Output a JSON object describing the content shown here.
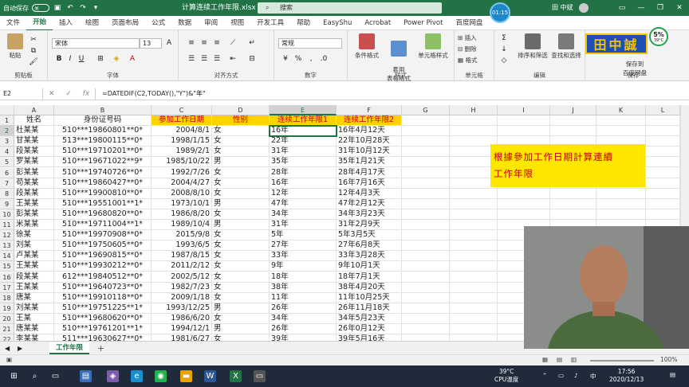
{
  "titlebar": {
    "autosave_label": "自动保存",
    "autosave_state": "关",
    "doc_title": "计算连续工作年限.xlsx",
    "search_placeholder": "搜索",
    "timer": "01:15",
    "user_name": "田 中斌",
    "win_minimize": "—",
    "win_restore": "❐",
    "win_close": "✕"
  },
  "tabs": [
    "文件",
    "开始",
    "插入",
    "绘图",
    "页面布局",
    "公式",
    "数据",
    "审阅",
    "视图",
    "开发工具",
    "帮助",
    "EasyShu",
    "Acrobat",
    "Power Pivot",
    "百度网盘"
  ],
  "active_tab": "开始",
  "ribbon": {
    "paste": "粘贴",
    "clipboard": "剪贴板",
    "font_name": "宋体",
    "font_size": "13",
    "font_group": "字体",
    "align_group": "对齐方式",
    "number_format": "常规",
    "number_group": "数字",
    "conditional": "条件格式",
    "table_format": "套用\n表格格式",
    "cell_style": "单元格样式",
    "styles_group": "样式",
    "insert": "插入",
    "delete": "删除",
    "format": "格式",
    "cells_group": "单元格",
    "sort_filter": "排序和筛选",
    "find_select": "查找和选择",
    "edit_group": "编辑",
    "save_to": "保存到\n百度网盘",
    "save_group": "保存",
    "logo_text": "田中誠",
    "badge_pct": "5%",
    "badge_temp": "39°C"
  },
  "formula_bar": {
    "name_box": "E2",
    "cancel": "✕",
    "enter": "✓",
    "fx": "fx",
    "formula": "=DATEDIF(C2,TODAY(),\"Y\")&\"年\""
  },
  "columns": [
    "A",
    "B",
    "C",
    "D",
    "E",
    "F",
    "G",
    "H",
    "I",
    "J",
    "K",
    "L"
  ],
  "selected_column": "E",
  "header_row": {
    "a": "姓名",
    "b": "身份证号码",
    "c": "参加工作日期",
    "d": "性别",
    "e": "连续工作年限1",
    "f": "连续工作年限2"
  },
  "rows": [
    {
      "n": "2",
      "a": "杜某某",
      "b": "510***19860801**0*",
      "c": "2004/8/1",
      "d": "女",
      "e": "16年",
      "f": "16年4月12天"
    },
    {
      "n": "3",
      "a": "甘某某",
      "b": "513***19800115**0*",
      "c": "1998/1/15",
      "d": "女",
      "e": "22年",
      "f": "22年10月28天"
    },
    {
      "n": "4",
      "a": "段某某",
      "b": "510***19710201**0*",
      "c": "1989/2/1",
      "d": "女",
      "e": "31年",
      "f": "31年10月12天"
    },
    {
      "n": "5",
      "a": "罗某某",
      "b": "510***19671022**9*",
      "c": "1985/10/22",
      "d": "男",
      "e": "35年",
      "f": "35年1月21天"
    },
    {
      "n": "6",
      "a": "彭某某",
      "b": "510***19740726**0*",
      "c": "1992/7/26",
      "d": "女",
      "e": "28年",
      "f": "28年4月17天"
    },
    {
      "n": "7",
      "a": "苟某某",
      "b": "510***19860427**0*",
      "c": "2004/4/27",
      "d": "女",
      "e": "16年",
      "f": "16年7月16天"
    },
    {
      "n": "8",
      "a": "段某某",
      "b": "510***19900810**0*",
      "c": "2008/8/10",
      "d": "女",
      "e": "12年",
      "f": "12年4月3天"
    },
    {
      "n": "9",
      "a": "王某某",
      "b": "510***19551001**1*",
      "c": "1973/10/1",
      "d": "男",
      "e": "47年",
      "f": "47年2月12天"
    },
    {
      "n": "10",
      "a": "彭某某",
      "b": "510***19680820**0*",
      "c": "1986/8/20",
      "d": "女",
      "e": "34年",
      "f": "34年3月23天"
    },
    {
      "n": "11",
      "a": "米某某",
      "b": "510***19711004**1*",
      "c": "1989/10/4",
      "d": "男",
      "e": "31年",
      "f": "31年2月9天"
    },
    {
      "n": "12",
      "a": "徐某",
      "b": "510***19970908**0*",
      "c": "2015/9/8",
      "d": "女",
      "e": "5年",
      "f": "5年3月5天"
    },
    {
      "n": "13",
      "a": "刘某",
      "b": "510***19750605**0*",
      "c": "1993/6/5",
      "d": "女",
      "e": "27年",
      "f": "27年6月8天"
    },
    {
      "n": "14",
      "a": "卢某某",
      "b": "510***19690815**0*",
      "c": "1987/8/15",
      "d": "女",
      "e": "33年",
      "f": "33年3月28天"
    },
    {
      "n": "15",
      "a": "王某某",
      "b": "510***19930212**0*",
      "c": "2011/2/12",
      "d": "女",
      "e": "9年",
      "f": "9年10月1天"
    },
    {
      "n": "16",
      "a": "段某某",
      "b": "612***19840512**0*",
      "c": "2002/5/12",
      "d": "女",
      "e": "18年",
      "f": "18年7月1天"
    },
    {
      "n": "17",
      "a": "王某某",
      "b": "510***19640723**0*",
      "c": "1982/7/23",
      "d": "女",
      "e": "38年",
      "f": "38年4月20天"
    },
    {
      "n": "18",
      "a": "唐某",
      "b": "510***19910118**0*",
      "c": "2009/1/18",
      "d": "女",
      "e": "11年",
      "f": "11年10月25天"
    },
    {
      "n": "19",
      "a": "刘某某",
      "b": "510***19751225**1*",
      "c": "1993/12/25",
      "d": "男",
      "e": "26年",
      "f": "26年11月18天"
    },
    {
      "n": "20",
      "a": "王某",
      "b": "510***19680620**0*",
      "c": "1986/6/20",
      "d": "女",
      "e": "34年",
      "f": "34年5月23天"
    },
    {
      "n": "21",
      "a": "唐某某",
      "b": "510***19761201**1*",
      "c": "1994/12/1",
      "d": "男",
      "e": "26年",
      "f": "26年0月12天"
    },
    {
      "n": "22",
      "a": "李某某",
      "b": "511***19630627**0*",
      "c": "1981/6/27",
      "d": "女",
      "e": "39年",
      "f": "39年5月16天"
    },
    {
      "n": "23",
      "a": "吴某某",
      "b": "510***19580211**0*",
      "c": "1976/2/11",
      "d": "女",
      "e": "44年",
      "f": "44年0月2天"
    }
  ],
  "annotation": {
    "line1": "根據參加工作日期計算連續",
    "line2": "工作年限"
  },
  "sheet_tab": "工作年限",
  "add_sheet": "+",
  "statusbar": {
    "zoom": "100%"
  },
  "taskbar": {
    "temp": "39°C",
    "cpu": "CPU温度",
    "time": "17:56",
    "date": "2020/12/13",
    "ime": "中"
  }
}
